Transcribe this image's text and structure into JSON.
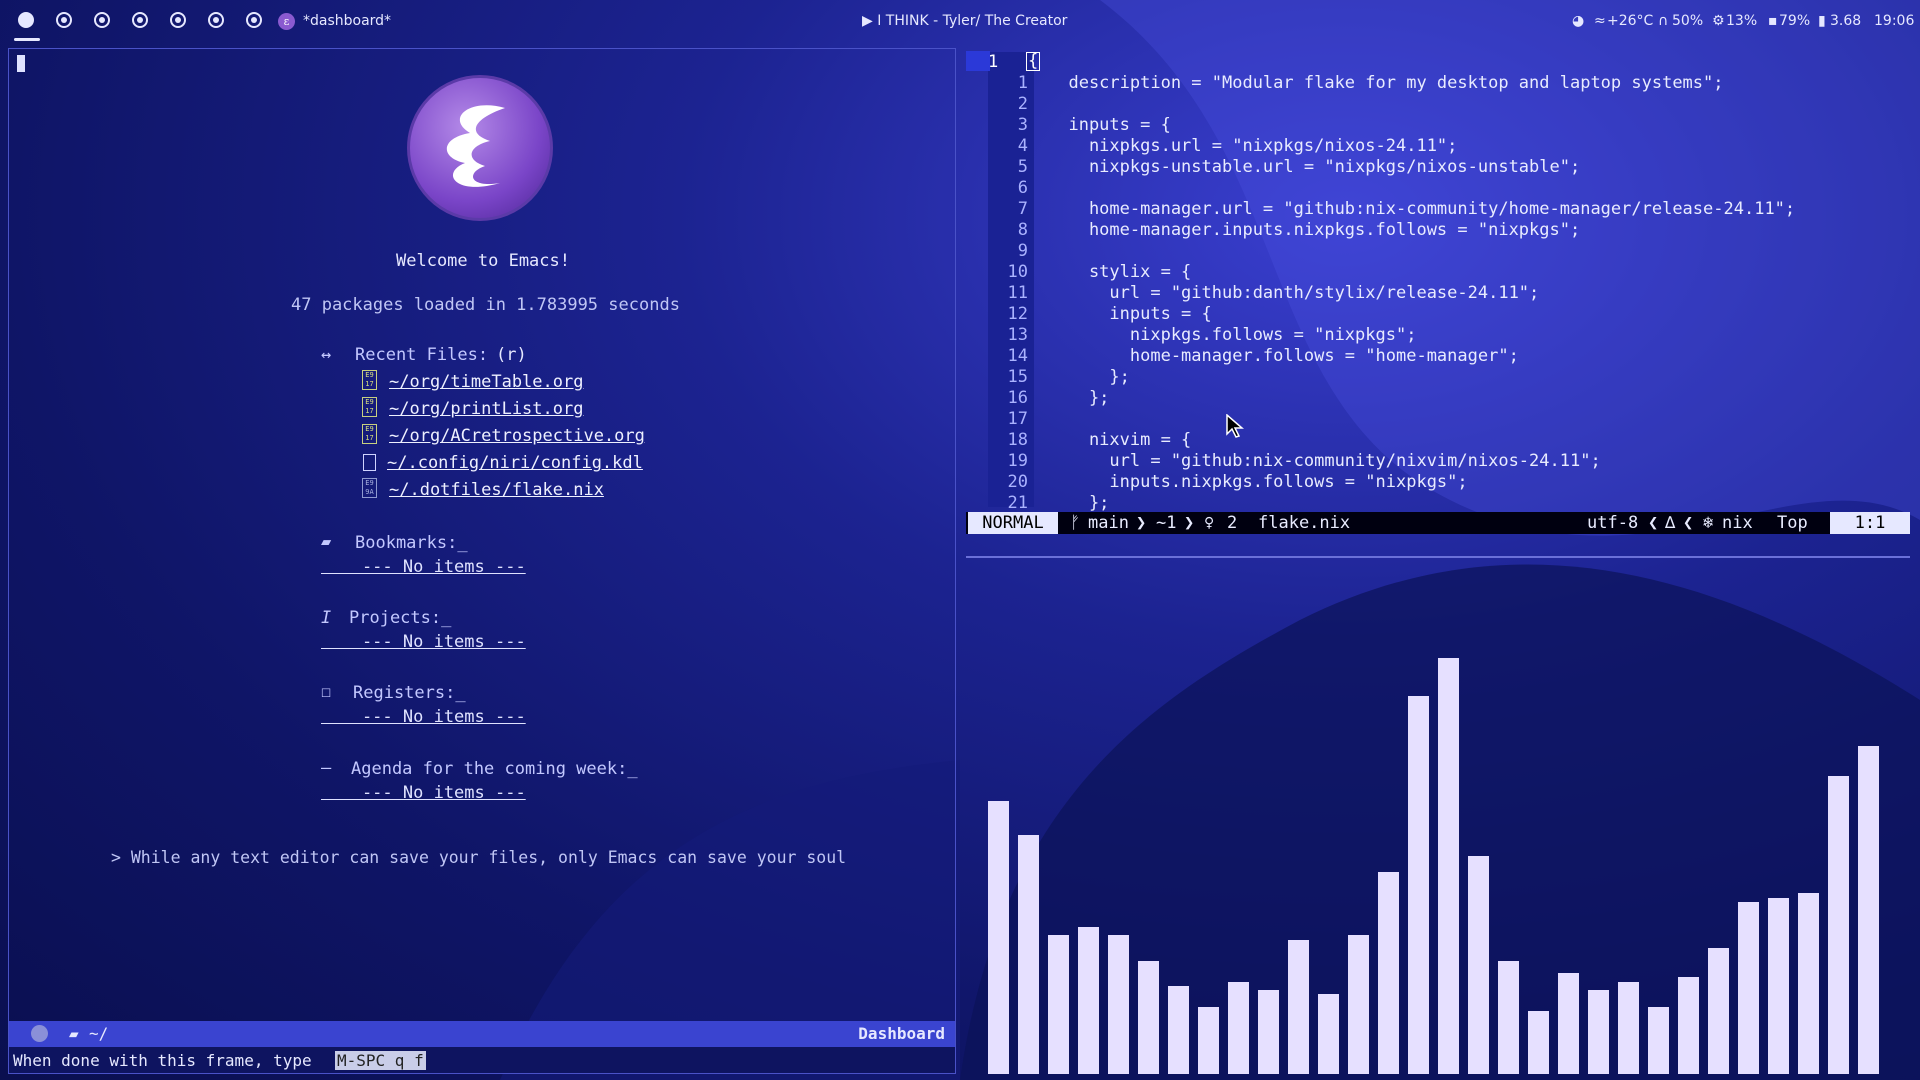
{
  "topbar": {
    "workspaces": [
      "1",
      "2",
      "3",
      "4",
      "5",
      "6",
      "7"
    ],
    "active_workspace": "1",
    "window_title": "*dashboard*",
    "media": "▶  I THINK - Tyler/ The Creator",
    "weather": "+26°C",
    "volume": "50%",
    "cpu": "13%",
    "memory": "79%",
    "load": "3.68",
    "clock": "19:06"
  },
  "dashboard": {
    "welcome": "Welcome to Emacs!",
    "packages": "47 packages loaded in 1.783995 seconds",
    "recent_heading": "Recent Files:",
    "recent_key": "(r)",
    "recent_files": [
      {
        "icon": "E9\n17",
        "path": "~/org/timeTable.org"
      },
      {
        "icon": "E9\n17",
        "path": "~/org/printList.org"
      },
      {
        "icon": "E9\n17",
        "path": "~/org/ACretrospective.org"
      },
      {
        "icon": "",
        "path": "~/.config/niri/config.kdl"
      },
      {
        "icon": "E9\n9A",
        "path": "~/.dotfiles/flake.nix"
      }
    ],
    "bookmarks_heading": "Bookmarks:_",
    "projects_heading": "Projects:_",
    "registers_heading": "Registers:_",
    "agenda_heading": "Agenda for the coming week:_",
    "no_items": "    --- No items ---",
    "quote": "> While any text editor can save your files, only Emacs can save your soul",
    "modeline_path": "~/",
    "modeline_mode": "Dashboard",
    "echo": "When done with this frame, type ",
    "echo_key": "M-SPC q f"
  },
  "editor": {
    "current_line": "1",
    "lines": [
      {
        "n": "1",
        "t": "  description = \"Modular flake for my desktop and laptop systems\";"
      },
      {
        "n": "2",
        "t": ""
      },
      {
        "n": "3",
        "t": "  inputs = {"
      },
      {
        "n": "4",
        "t": "    nixpkgs.url = \"nixpkgs/nixos-24.11\";"
      },
      {
        "n": "5",
        "t": "    nixpkgs-unstable.url = \"nixpkgs/nixos-unstable\";"
      },
      {
        "n": "6",
        "t": ""
      },
      {
        "n": "7",
        "t": "    home-manager.url = \"github:nix-community/home-manager/release-24.11\";"
      },
      {
        "n": "8",
        "t": "    home-manager.inputs.nixpkgs.follows = \"nixpkgs\";"
      },
      {
        "n": "9",
        "t": ""
      },
      {
        "n": "10",
        "t": "    stylix = {"
      },
      {
        "n": "11",
        "t": "      url = \"github:danth/stylix/release-24.11\";"
      },
      {
        "n": "12",
        "t": "      inputs = {"
      },
      {
        "n": "13",
        "t": "        nixpkgs.follows = \"nixpkgs\";"
      },
      {
        "n": "14",
        "t": "        home-manager.follows = \"home-manager\";"
      },
      {
        "n": "15",
        "t": "      };"
      },
      {
        "n": "16",
        "t": "    };"
      },
      {
        "n": "17",
        "t": ""
      },
      {
        "n": "18",
        "t": "    nixvim = {"
      },
      {
        "n": "19",
        "t": "      url = \"github:nix-community/nixvim/nixos-24.11\";"
      },
      {
        "n": "20",
        "t": "      inputs.nixpkgs.follows = \"nixpkgs\";"
      },
      {
        "n": "21",
        "t": "    };"
      }
    ],
    "first_line_char": "{",
    "mode": "NORMAL",
    "branch": "main",
    "diff": "~1",
    "diagnostics": "2",
    "filename": "flake.nix",
    "encoding": "utf-8",
    "filetype": "nix",
    "scroll": "Top",
    "position": "1:1"
  },
  "visualizer": {
    "levels": [
      0.65,
      0.57,
      0.33,
      0.35,
      0.33,
      0.27,
      0.21,
      0.16,
      0.22,
      0.2,
      0.32,
      0.19,
      0.33,
      0.48,
      0.9,
      0.99,
      0.52,
      0.27,
      0.15,
      0.24,
      0.2,
      0.22,
      0.16,
      0.23,
      0.3,
      0.41,
      0.42,
      0.43,
      0.71,
      0.78
    ]
  }
}
